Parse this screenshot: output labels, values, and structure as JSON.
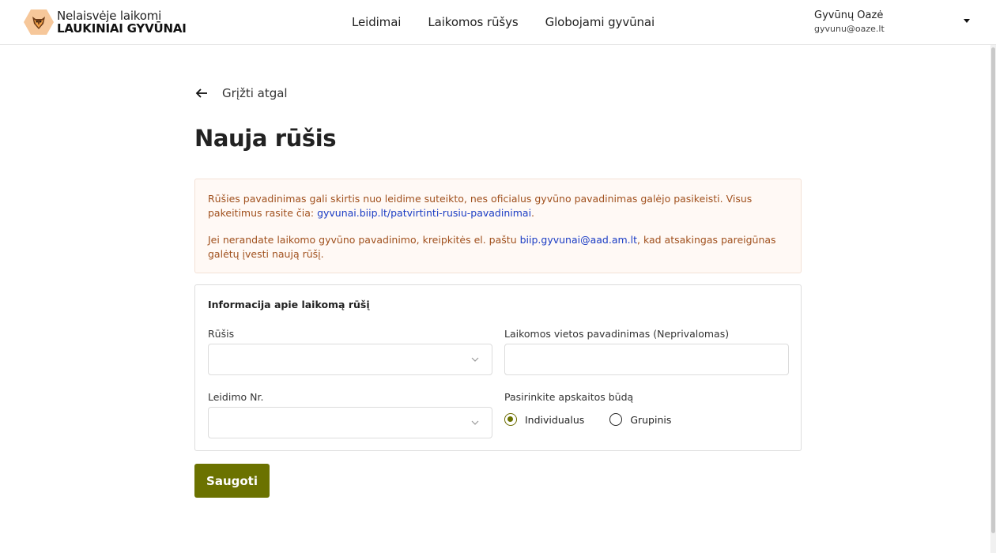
{
  "header": {
    "logo_line1": "Nelaisvėje laikomi",
    "logo_line2": "LAUKINIAI GYVŪNAI",
    "logo_icon": "fox-hexagon-icon",
    "nav": [
      {
        "label": "Leidimai"
      },
      {
        "label": "Laikomos rūšys"
      },
      {
        "label": "Globojami gyvūnai"
      }
    ],
    "user_name": "Gyvūnų Oazė",
    "user_email": "gyvunu@oaze.lt"
  },
  "back_label": "Grįžti atgal",
  "page_title": "Nauja rūšis",
  "notice": {
    "p1_text": "Rūšies pavadinimas gali skirtis nuo leidime suteikto, nes oficialus gyvūno pavadinimas galėjo pasikeisti. Visus pakeitimus rasite čia: ",
    "p1_link": "gyvunai.biip.lt/patvirtinti-rusiu-pavadinimai",
    "p1_end": ".",
    "p2_text": "Jei nerandate laikomo gyvūno pavadinimo, kreipkitės el. paštu ",
    "p2_link": "biip.gyvunai@aad.am.lt",
    "p2_end": ", kad atsakingas pareigūnas galėtų įvesti naują rūšį."
  },
  "form": {
    "section_title": "Informacija apie laikomą rūšį",
    "species_label": "Rūšis",
    "species_value": "",
    "location_label": "Laikomos vietos pavadinimas (Neprivalomas)",
    "location_value": "",
    "permit_label": "Leidimo Nr.",
    "permit_value": "",
    "accounting_label": "Pasirinkite apskaitos būdą",
    "options": [
      {
        "label": "Individualus",
        "checked": true
      },
      {
        "label": "Grupinis",
        "checked": false
      }
    ]
  },
  "save_label": "Saugoti",
  "colors": {
    "accent": "#6b7200",
    "notice_text": "#a0501d",
    "notice_bg": "#fff9f5",
    "link": "#1a3cc4",
    "logo_hex": "#f6c79a"
  }
}
